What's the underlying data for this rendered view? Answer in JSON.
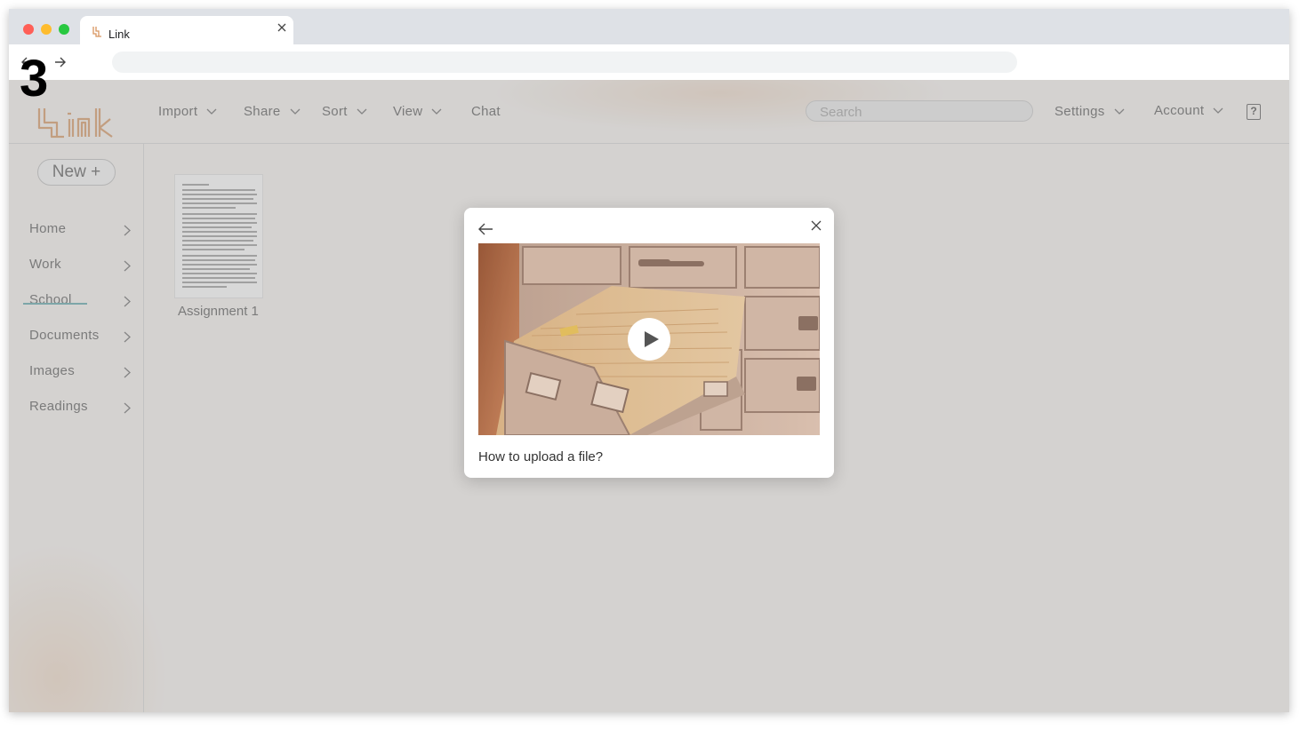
{
  "step": {
    "number": "3"
  },
  "browser": {
    "tab_title": "Link"
  },
  "app": {
    "logo_text": "Link",
    "brand_color": "#d8955f",
    "menu": {
      "import": "Import",
      "share": "Share",
      "sort": "Sort",
      "view": "View",
      "chat": "Chat",
      "settings": "Settings",
      "account": "Account",
      "help": "?"
    },
    "search": {
      "placeholder": "Search"
    },
    "new_button": "New +",
    "sidebar": {
      "items": [
        {
          "label": "Home"
        },
        {
          "label": "Work"
        },
        {
          "label": "School",
          "selected": true
        },
        {
          "label": "Documents"
        },
        {
          "label": "Images"
        },
        {
          "label": "Readings"
        }
      ],
      "accent_color": "#5aa5a8"
    },
    "files": [
      {
        "name": "Assignment 1"
      }
    ]
  },
  "modal": {
    "video_title": "How to upload a file?",
    "icons": [
      "arrow-left-icon",
      "close-icon",
      "play-icon"
    ]
  }
}
